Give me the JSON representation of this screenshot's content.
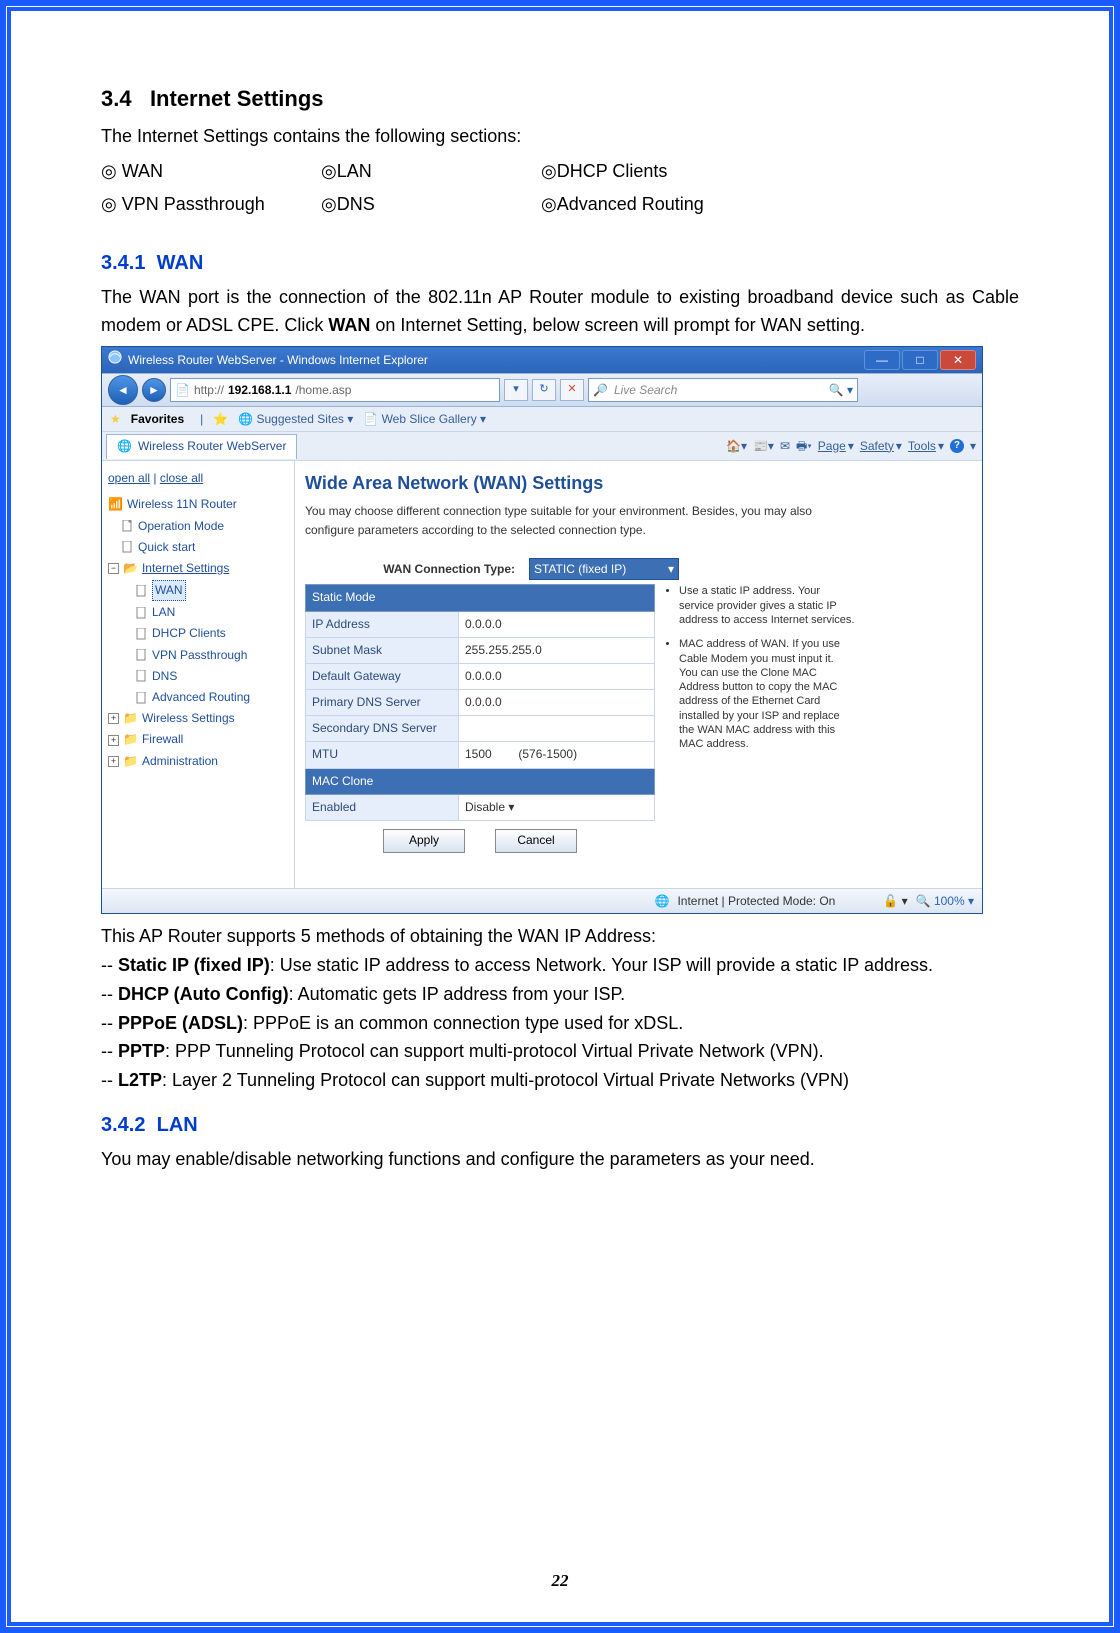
{
  "section": {
    "num": "3.4",
    "title": "Internet Settings"
  },
  "intro": "The Internet Settings contains the following sections:",
  "cols": [
    "◎  WAN",
    "◎LAN",
    "◎DHCP Clients",
    "◎  VPN Passthrough",
    "◎DNS",
    "◎Advanced Routing"
  ],
  "s341": {
    "num": "3.4.1",
    "title": "WAN"
  },
  "p341a": "The WAN port is the connection of the 802.11n AP Router module to existing broadband device such as Cable modem or ADSL CPE. Click ",
  "p341b": "WAN",
  "p341c": " on Internet Setting, below screen will prompt for WAN setting.",
  "shot": {
    "title": "Wireless Router WebServer - Windows Internet Explorer",
    "url_prefix": "http://",
    "url_host": "192.168.1.1",
    "url_path": "/home.asp",
    "searchPlaceholder": "Live Search",
    "favLabel": "Favorites",
    "suggested": "Suggested Sites",
    "webslice": "Web Slice Gallery",
    "tab": "Wireless Router WebServer",
    "toolbar": {
      "page": "Page",
      "safety": "Safety",
      "tools": "Tools"
    },
    "side": {
      "open": "open all",
      "close": "close all",
      "root": "Wireless 11N Router",
      "items": [
        "Operation Mode",
        "Quick start"
      ],
      "internet": "Internet Settings",
      "internet_items": [
        "WAN",
        "LAN",
        "DHCP Clients",
        "VPN Passthrough",
        "DNS",
        "Advanced Routing"
      ],
      "others": [
        "Wireless Settings",
        "Firewall",
        "Administration"
      ]
    },
    "main": {
      "h": "Wide Area Network (WAN) Settings",
      "sub": "You may choose different connection type suitable for your environment. Besides, you may also configure parameters according to the selected connection type.",
      "connLabel": "WAN Connection Type:",
      "connValue": "STATIC (fixed IP)",
      "staticHdr": "Static Mode",
      "rows": [
        [
          "IP Address",
          "0.0.0.0"
        ],
        [
          "Subnet Mask",
          "255.255.255.0"
        ],
        [
          "Default Gateway",
          "0.0.0.0"
        ],
        [
          "Primary DNS Server",
          "0.0.0.0"
        ],
        [
          "Secondary DNS Server",
          ""
        ],
        [
          "MTU",
          "1500"
        ]
      ],
      "mtuRange": "(576-1500)",
      "macHdr": "MAC Clone",
      "macRow": [
        "Enabled",
        "Disable"
      ],
      "hint1": "Use a static IP address. Your service provider gives a static IP address to access Internet services.",
      "hint2": "MAC address of WAN. If you use Cable Modem you must input it. You can use the Clone MAC Address button to copy the MAC address of the Ethernet Card installed by your ISP and replace the WAN MAC address with this MAC address.",
      "apply": "Apply",
      "cancel": "Cancel"
    },
    "status": {
      "mode": "Internet | Protected Mode: On",
      "zoom": "100%"
    }
  },
  "postIntro": "This AP Router supports 5 methods of obtaining the WAN IP Address:",
  "m1b": "Static IP (fixed IP)",
  "m1t": ": Use static IP address to access Network. Your ISP will provide a static IP address.",
  "m2b": "DHCP (Auto Config)",
  "m2t": ": Automatic gets IP address from your ISP.",
  "m3b": "PPPoE (ADSL)",
  "m3t": ": PPPoE is an common connection type used for xDSL.",
  "m4b": "PPTP",
  "m4t": ": PPP Tunneling Protocol can support multi-protocol Virtual Private Network (VPN).",
  "m5b": "L2TP",
  "m5t": ": Layer 2 Tunneling Protocol can support multi-protocol Virtual Private Networks (VPN)",
  "s342": {
    "num": "3.4.2",
    "title": "LAN"
  },
  "p342": "You may enable/disable networking functions and configure the parameters as your need.",
  "pageNo": "22"
}
